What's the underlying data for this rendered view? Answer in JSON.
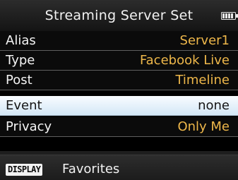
{
  "header": {
    "title": "Streaming Server Set",
    "battery_icon": "battery-icon"
  },
  "menu": {
    "items": [
      {
        "label": "Alias",
        "value": "Server1",
        "selected": false
      },
      {
        "label": "Type",
        "value": "Facebook Live",
        "selected": false
      },
      {
        "label": "Post",
        "value": "Timeline",
        "selected": false
      },
      {
        "label": "Event",
        "value": "none",
        "selected": true
      },
      {
        "label": "Privacy",
        "value": "Only Me",
        "selected": false
      }
    ]
  },
  "footer": {
    "key_label": "DISPLAY",
    "action_label": "Favorites"
  },
  "colors": {
    "value_text": "#eeb74a",
    "selected_row": "#e4f0fa",
    "background": "#000000"
  }
}
